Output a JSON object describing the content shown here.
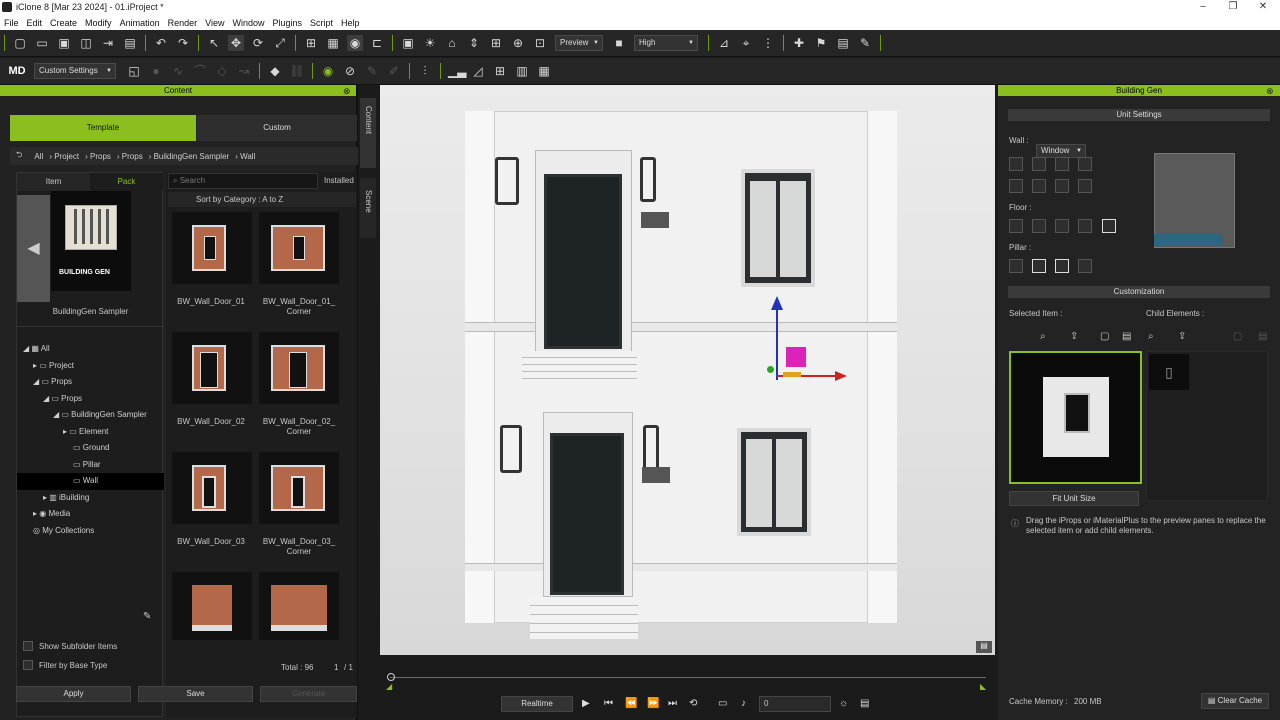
{
  "window": {
    "title": "iClone 8 [Mar 23 2024] - 01.iProject *"
  },
  "menu": [
    "File",
    "Edit",
    "Create",
    "Modify",
    "Animation",
    "Render",
    "View",
    "Window",
    "Plugins",
    "Script",
    "Help"
  ],
  "toolbar": {
    "preview": "Preview",
    "quality": "High",
    "custom_settings": "Custom Settings"
  },
  "content": {
    "header": "Content",
    "tab_template": "Template",
    "tab_custom": "Custom",
    "breadcrumb": [
      "All",
      "Project",
      "Props",
      "Props",
      "BuildingGen Sampler",
      "Wall"
    ],
    "subtab_item": "Item",
    "subtab_pack": "Pack",
    "search_placeholder": "Search",
    "installed": "Installed",
    "sort": "Sort by Category : A to Z",
    "pack_name": "BuildingGen Sampler",
    "pack_logo": "BUILDING GEN",
    "tree": [
      "All",
      "Project",
      "Props",
      "Props",
      "BuildingGen Sampler",
      "Element",
      "Ground",
      "Pillar",
      "Wall",
      "iBuilding",
      "Media",
      "My Collections"
    ],
    "items": [
      "BW_Wall_Door_01",
      "BW_Wall_Door_01_ Corner",
      "BW_Wall_Door_02",
      "BW_Wall_Door_02_ Corner",
      "BW_Wall_Door_03",
      "BW_Wall_Door_03_ Corner"
    ],
    "show_subfolder": "Show Subfolder Items",
    "filter_base": "Filter by Base Type",
    "total": "Total : 96",
    "page": "1",
    "pages": "/ 1",
    "apply": "Apply",
    "save": "Save",
    "generate": "Generate",
    "side_tab_content": "Content",
    "side_tab_scene": "Scene"
  },
  "building_gen": {
    "header": "Building Gen",
    "unit_settings": "Unit Settings",
    "wall_label": "Wall :",
    "wall_type": "Window",
    "floor_label": "Floor :",
    "pillar_label": "Pillar :",
    "customization": "Customization",
    "selected_item": "Selected Item :",
    "child_elements": "Child Elements :",
    "fit_unit_size": "Fit Unit Size",
    "hint": "Drag the iProps or iMaterialPlus to the preview panes to replace the selected item or add child elements.",
    "cache_label": "Cache Memory :",
    "cache_value": "200 MB",
    "clear_cache": "Clear Cache"
  },
  "timeline": {
    "realtime": "Realtime",
    "frame": "0"
  },
  "colors": {
    "accent": "#8bbf1e"
  }
}
